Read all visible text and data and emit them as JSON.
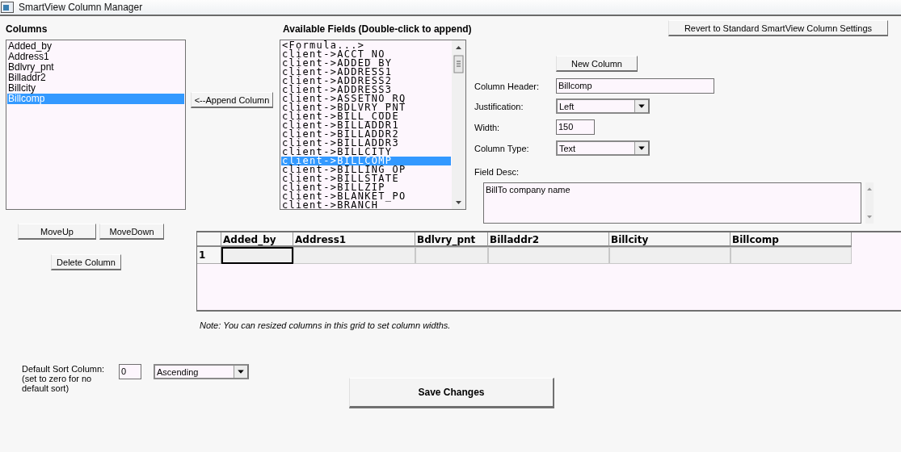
{
  "window": {
    "title": "SmartView Column Manager"
  },
  "columns_panel": {
    "heading": "Columns",
    "items": [
      {
        "label": "Added_by",
        "selected": false
      },
      {
        "label": "Address1",
        "selected": false
      },
      {
        "label": "Bdlvry_pnt",
        "selected": false
      },
      {
        "label": "Billaddr2",
        "selected": false
      },
      {
        "label": "Billcity",
        "selected": false
      },
      {
        "label": "Billcomp",
        "selected": true
      }
    ]
  },
  "append_button": "<--Append Column",
  "available_fields": {
    "heading": "Available Fields (Double-click to append)",
    "items": [
      {
        "label": "<Formula...>",
        "selected": false
      },
      {
        "label": "client->ACCT_NO",
        "selected": false
      },
      {
        "label": "client->ADDED_BY",
        "selected": false
      },
      {
        "label": "client->ADDRESS1",
        "selected": false
      },
      {
        "label": "client->ADDRESS2",
        "selected": false
      },
      {
        "label": "client->ADDRESS3",
        "selected": false
      },
      {
        "label": "client->ASSETNO_RQ",
        "selected": false
      },
      {
        "label": "client->BDLVRY_PNT",
        "selected": false
      },
      {
        "label": "client->BILL_CODE",
        "selected": false
      },
      {
        "label": "client->BILLADDR1",
        "selected": false
      },
      {
        "label": "client->BILLADDR2",
        "selected": false
      },
      {
        "label": "client->BILLADDR3",
        "selected": false
      },
      {
        "label": "client->BILLCITY",
        "selected": false
      },
      {
        "label": "client->BILLCOMP",
        "selected": true
      },
      {
        "label": "client->BILLING_OP",
        "selected": false
      },
      {
        "label": "client->BILLSTATE",
        "selected": false
      },
      {
        "label": "client->BILLZIP",
        "selected": false
      },
      {
        "label": "client->BLANKET_PO",
        "selected": false
      },
      {
        "label": "client->BRANCH",
        "selected": false
      }
    ]
  },
  "revert_button": "Revert to Standard SmartView Column Settings",
  "new_column_button": "New Column",
  "properties": {
    "column_header": {
      "label": "Column Header:",
      "value": "Billcomp"
    },
    "justification": {
      "label": "Justification:",
      "value": "Left"
    },
    "width": {
      "label": "Width:",
      "value": "150"
    },
    "column_type": {
      "label": "Column Type:",
      "value": "Text"
    },
    "field_desc": {
      "label": "Field Desc:",
      "value": "BillTo company name"
    }
  },
  "move_up_button": "MoveUp",
  "move_down_button": "MoveDown",
  "delete_column_button": "Delete Column",
  "grid": {
    "columns": [
      "Added_by",
      "Address1",
      "Bdlvry_pnt",
      "Billaddr2",
      "Billcity",
      "Billcomp"
    ],
    "rows": [
      {
        "number": "1",
        "cells": [
          {
            "selected": true
          },
          {
            "selected": false
          },
          {
            "selected": false
          },
          {
            "selected": false
          },
          {
            "selected": false
          },
          {
            "selected": false
          }
        ]
      }
    ]
  },
  "note": "Note: You can resized columns in this grid to set column widths.",
  "default_sort": {
    "label": "Default Sort Column:",
    "hint": "(set to zero for no default sort)",
    "column": "0",
    "order": "Ascending"
  },
  "save_button": "Save Changes"
}
